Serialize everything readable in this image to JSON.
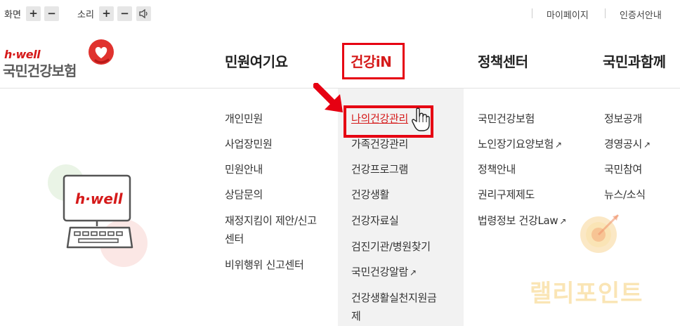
{
  "utility": {
    "screen_label": "화면",
    "sound_label": "소리",
    "plus": "+",
    "minus": "−",
    "mypage": "마이페이지",
    "cert": "인증서안내"
  },
  "logo": {
    "small": "h·well",
    "main": "국민건강보험"
  },
  "nav": {
    "items": [
      "민원여기요",
      "건강iN",
      "정책센터",
      "국민과함께"
    ],
    "active": "건강iN"
  },
  "menu": {
    "col1": [
      "개인민원",
      "사업장민원",
      "민원안내",
      "상담문의",
      "재정지킴이 제안/신고",
      "센터",
      "비위행위 신고센터"
    ],
    "col2": [
      "나의건강관리",
      "가족건강관리",
      "건강프로그램",
      "건강생활",
      "건강자료실",
      "검진기관/병원찾기",
      "국민건강알람",
      "건강생활실천지원금",
      "제"
    ],
    "col3": [
      "국민건강보험",
      "노인장기요양보험",
      "정책안내",
      "권리구제제도",
      "법령정보 건강Law"
    ],
    "col4": [
      "정보공개",
      "경영공시",
      "국민참여",
      "뉴스/소식"
    ]
  },
  "illustration": {
    "brand": "h·well"
  },
  "watermark": {
    "text": "랠리포인트"
  },
  "colors": {
    "accent": "#e60012",
    "brand_red": "#d51a1a",
    "menu_bg": "#f2f2f2"
  }
}
